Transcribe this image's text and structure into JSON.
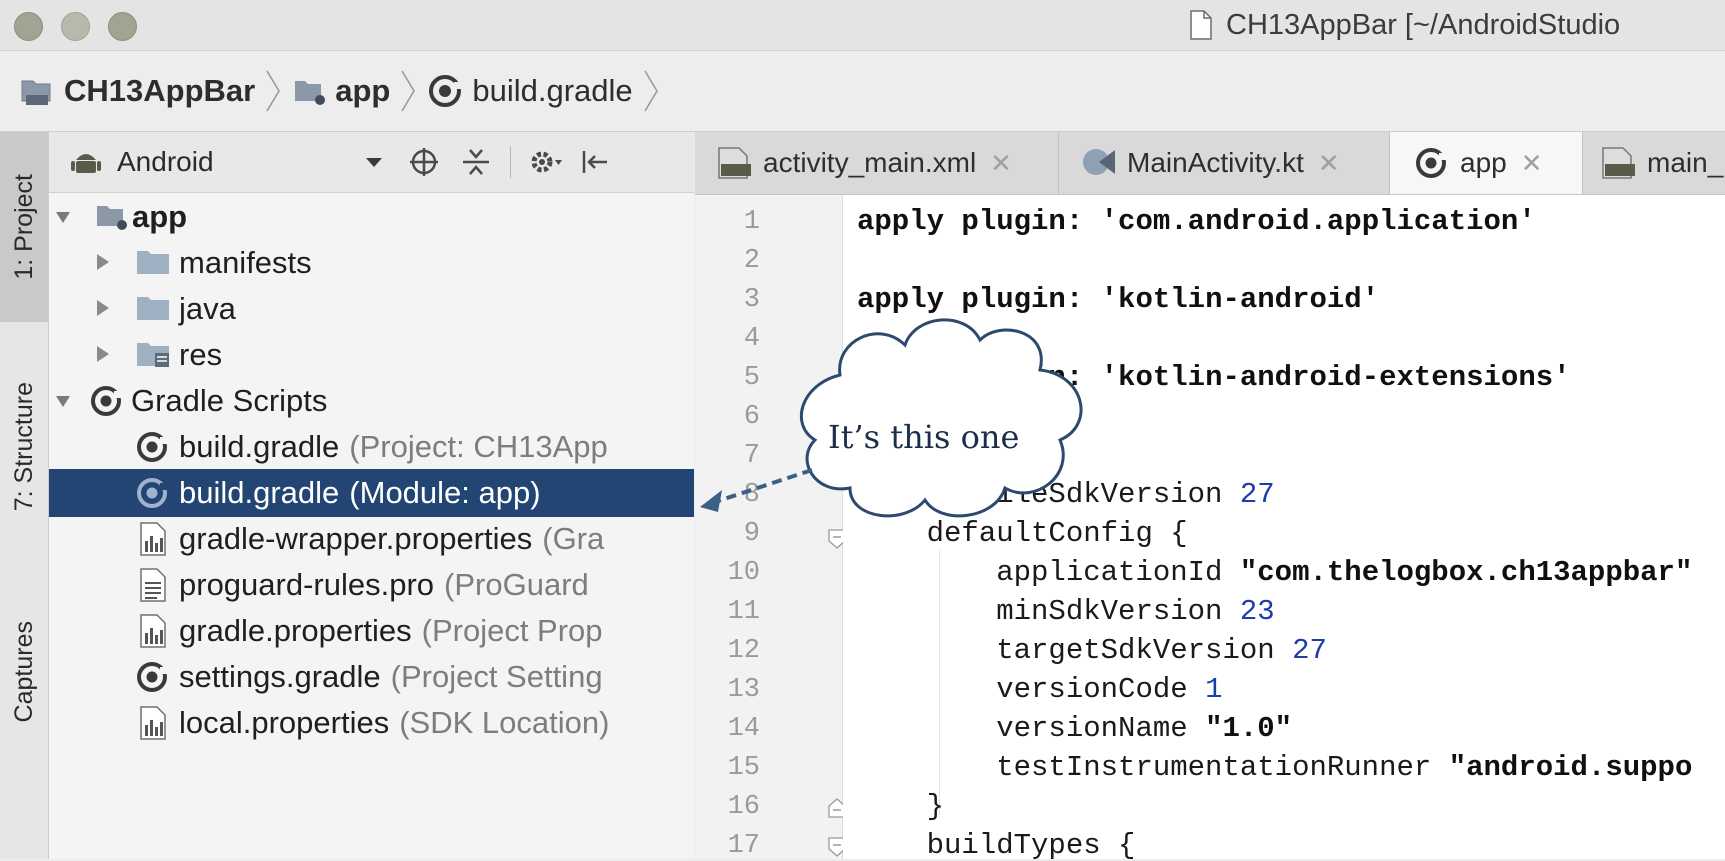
{
  "window": {
    "title": "CH13AppBar [~/AndroidStudio"
  },
  "breadcrumb": [
    "CH13AppBar",
    "app",
    "build.gradle"
  ],
  "tool_stripe": [
    {
      "label": "1: Project",
      "icon": "project-icon",
      "active": true
    },
    {
      "label": "7: Structure",
      "icon": "structure-icon",
      "active": false
    },
    {
      "label": "Captures",
      "icon": "captures-icon",
      "active": false
    }
  ],
  "project_panel": {
    "view_selector": "Android",
    "tree": [
      {
        "label": "app",
        "hint": "",
        "icon": "module-folder-icon",
        "expanded": true
      },
      {
        "label": "manifests",
        "hint": "",
        "icon": "folder-icon",
        "expanded": false
      },
      {
        "label": "java",
        "hint": "",
        "icon": "folder-icon",
        "expanded": false
      },
      {
        "label": "res",
        "hint": "",
        "icon": "res-folder-icon",
        "expanded": false
      },
      {
        "label": "Gradle Scripts",
        "hint": "",
        "icon": "gradle-icon",
        "expanded": true
      },
      {
        "label": "build.gradle",
        "hint": "(Project: CH13App",
        "icon": "gradle-file-icon"
      },
      {
        "label": "build.gradle",
        "hint": "(Module: app)",
        "icon": "gradle-file-icon",
        "selected": true
      },
      {
        "label": "gradle-wrapper.properties",
        "hint": "(Gra",
        "icon": "properties-file-icon"
      },
      {
        "label": "proguard-rules.pro",
        "hint": "(ProGuard",
        "icon": "text-file-icon"
      },
      {
        "label": "gradle.properties",
        "hint": "(Project Prop",
        "icon": "properties-file-icon"
      },
      {
        "label": "settings.gradle",
        "hint": "(Project Setting",
        "icon": "gradle-file-icon"
      },
      {
        "label": "local.properties",
        "hint": "(SDK Location)",
        "icon": "properties-file-icon"
      }
    ]
  },
  "tabs": [
    {
      "label": "activity_main.xml",
      "icon": "xml-file-icon",
      "active": false
    },
    {
      "label": "MainActivity.kt",
      "icon": "kotlin-file-icon",
      "active": false
    },
    {
      "label": "app",
      "icon": "gradle-file-icon",
      "active": true
    },
    {
      "label": "main_",
      "icon": "xml-file-icon",
      "active": false
    }
  ],
  "editor": {
    "line_numbers": [
      "1",
      "2",
      "3",
      "4",
      "5",
      "6",
      "7",
      "8",
      "9",
      "10",
      "11",
      "12",
      "13",
      "14",
      "15",
      "16",
      "17"
    ],
    "lines": [
      "apply plugin: 'com.android.application'",
      "",
      "apply plugin: 'kotlin-android'",
      "",
      "apply plugin: 'kotlin-android-extensions'",
      "",
      "",
      "    compileSdkVersion 27",
      "    defaultConfig {",
      "        applicationId \"com.thelogbox.ch13appbar\"",
      "        minSdkVersion 23",
      "        targetSdkVersion 27",
      "        versionCode 1",
      "        versionName \"1.0\"",
      "        testInstrumentationRunner \"android.suppo",
      "    }",
      "    buildTypes {"
    ],
    "visible_fragments": {
      "line5": ": 'kotlin-android-extensions'",
      "line8": "eSdkVersion 27"
    }
  },
  "callout": {
    "text": "It’s this one"
  },
  "colors": {
    "selection": "#234574",
    "callout_stroke": "#2d4a6e",
    "arrow": "#3b5f86"
  }
}
